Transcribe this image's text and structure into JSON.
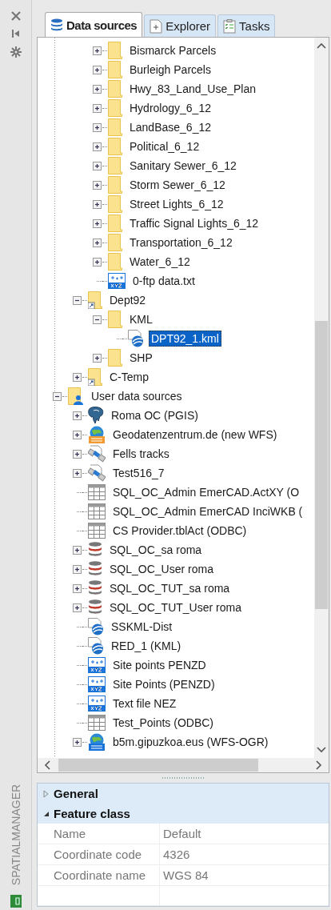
{
  "side_strip": {
    "title": "SPATIALMANAGER"
  },
  "tabs": [
    {
      "label": "Data sources",
      "kind": "database",
      "selected": true
    },
    {
      "label": "Explorer",
      "kind": "explorer",
      "selected": false
    },
    {
      "label": "Tasks",
      "kind": "tasks",
      "selected": false
    }
  ],
  "tree": {
    "nodes": [
      {
        "children": [
          {
            "children": [
              {
                "label": "Bismarck Parcels",
                "kind": "folder",
                "expanded": false,
                "selected": false
              },
              {
                "label": "Burleigh Parcels",
                "kind": "folder",
                "expanded": false,
                "selected": false
              },
              {
                "label": "Hwy_83_Land_Use_Plan",
                "kind": "folder",
                "expanded": false,
                "selected": false
              },
              {
                "label": "Hydrology_6_12",
                "kind": "folder",
                "expanded": false,
                "selected": false
              },
              {
                "label": "LandBase_6_12",
                "kind": "folder",
                "expanded": false,
                "selected": false
              },
              {
                "label": "Political_6_12",
                "kind": "folder",
                "expanded": false,
                "selected": false
              },
              {
                "label": "Sanitary Sewer_6_12",
                "kind": "folder",
                "expanded": false,
                "selected": false
              },
              {
                "label": "Storm Sewer_6_12",
                "kind": "folder",
                "expanded": false,
                "selected": false
              },
              {
                "label": "Street Lights_6_12",
                "kind": "folder",
                "expanded": false,
                "selected": false
              },
              {
                "label": "Traffic Signal Lights_6_12",
                "kind": "folder",
                "expanded": false,
                "selected": false
              },
              {
                "label": "Transportation_6_12",
                "kind": "folder",
                "expanded": false,
                "selected": false
              },
              {
                "label": "Water_6_12",
                "kind": "folder",
                "expanded": false,
                "selected": false
              },
              {
                "label": "0-ftp data.txt",
                "kind": "xyz",
                "selected": false
              }
            ]
          },
          {
            "label": "Dept92",
            "kind": "folder-link",
            "expanded": true,
            "selected": false,
            "children": [
              {
                "label": "KML",
                "kind": "folder",
                "expanded": true,
                "selected": false,
                "children": [
                  {
                    "label": "DPT92_1.kml",
                    "kind": "kml",
                    "selected": true
                  }
                ]
              },
              {
                "label": "SHP",
                "kind": "folder",
                "expanded": false,
                "selected": false
              }
            ]
          },
          {
            "label": "C-Temp",
            "kind": "folder-link",
            "expanded": false,
            "selected": false
          }
        ]
      },
      {
        "label": "User data sources",
        "kind": "user-folder",
        "expanded": true,
        "selected": false,
        "children": [
          {
            "label": "Roma OC (PGIS)",
            "kind": "elephant",
            "expanded": false,
            "selected": false
          },
          {
            "label": "Geodatenzentrum.de (new WFS)",
            "kind": "wfs",
            "expanded": false,
            "selected": false
          },
          {
            "label": "Fells tracks",
            "kind": "satellite",
            "expanded": false,
            "selected": false
          },
          {
            "label": "Test516_7",
            "kind": "satellite",
            "expanded": false,
            "selected": false
          },
          {
            "label": "SQL_OC_Admin EmerCAD.ActXY (O",
            "kind": "table",
            "selected": false
          },
          {
            "label": "SQL_OC_Admin EmerCAD InciWKB (",
            "kind": "table",
            "selected": false
          },
          {
            "label": "CS Provider.tblAct (ODBC)",
            "kind": "table",
            "selected": false
          },
          {
            "label": "SQL_OC_sa roma",
            "kind": "database",
            "expanded": false,
            "selected": false
          },
          {
            "label": "SQL_OC_User roma",
            "kind": "database",
            "expanded": false,
            "selected": false
          },
          {
            "label": "SQL_OC_TUT_sa roma",
            "kind": "database",
            "expanded": false,
            "selected": false
          },
          {
            "label": "SQL_OC_TUT_User roma",
            "kind": "database",
            "expanded": false,
            "selected": false
          },
          {
            "label": "SSKML-Dist",
            "kind": "kml",
            "selected": false
          },
          {
            "label": "RED_1 (KML)",
            "kind": "kml",
            "selected": false
          },
          {
            "label": "Site points PENZD",
            "kind": "xyz",
            "selected": false
          },
          {
            "label": "Site Points (PENZD)",
            "kind": "xyz",
            "selected": false
          },
          {
            "label": "Text file NEZ",
            "kind": "xyz",
            "selected": false
          },
          {
            "label": "Test_Points (ODBC)",
            "kind": "table",
            "selected": false
          },
          {
            "label": "b5m.gipuzkoa.eus (WFS-OGR)",
            "kind": "ogr",
            "expanded": false,
            "selected": false
          }
        ]
      }
    ]
  },
  "properties": {
    "sections": [
      {
        "title": "General",
        "expanded": false
      },
      {
        "title": "Feature class",
        "expanded": true,
        "rows": [
          {
            "name": "Name",
            "value": "Default"
          },
          {
            "name": "Coordinate code",
            "value": "4326"
          },
          {
            "name": "Coordinate name",
            "value": "WGS 84"
          }
        ]
      }
    ]
  }
}
